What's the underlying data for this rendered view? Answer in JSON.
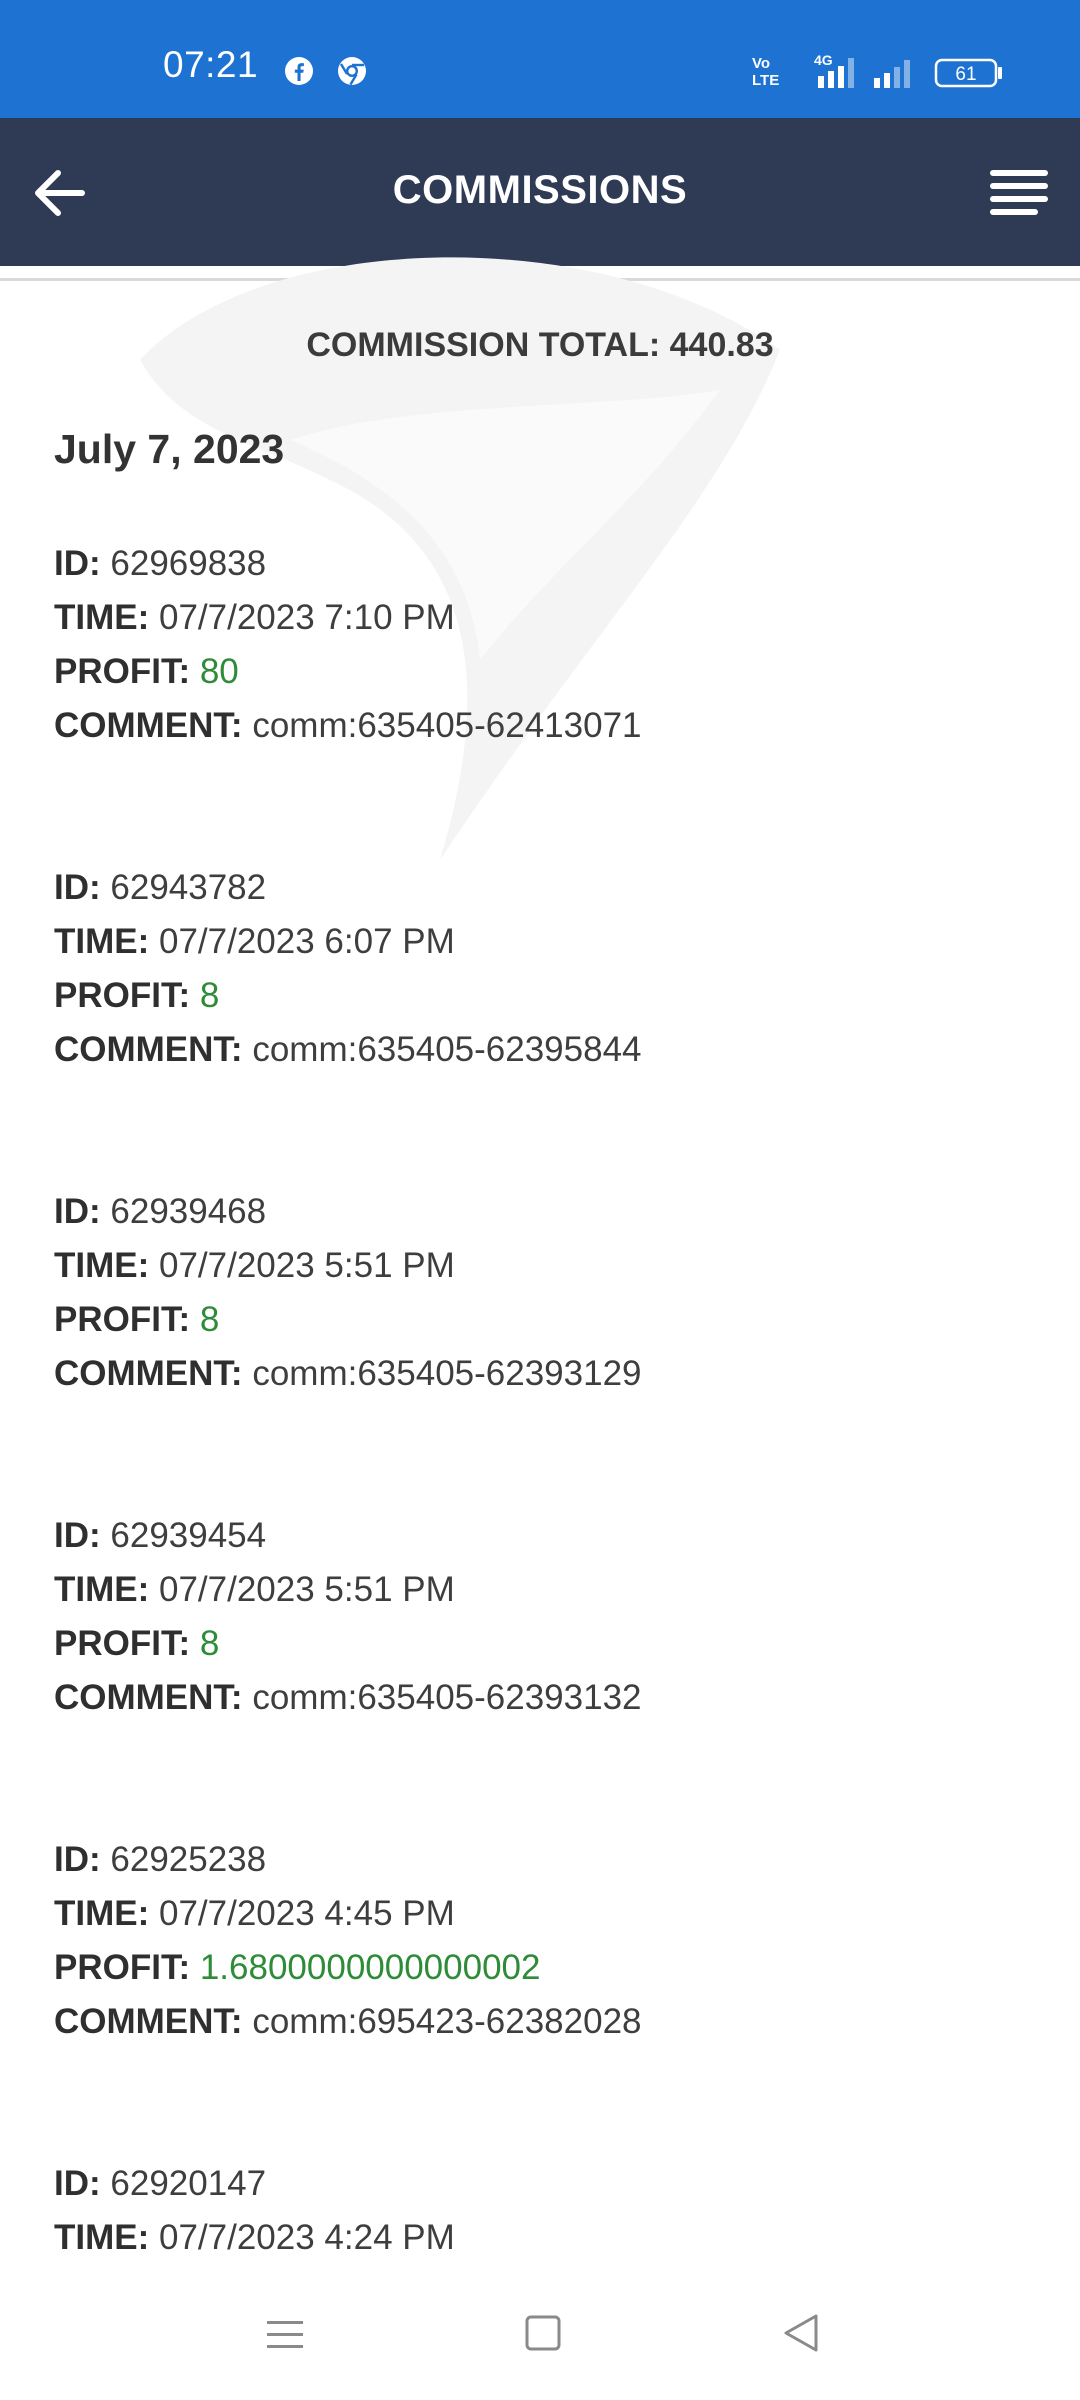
{
  "status_bar": {
    "time": "07:21",
    "icons": [
      "facebook-icon",
      "chrome-icon",
      "volte-icon",
      "signal-4g-icon",
      "signal-icon",
      "battery-icon"
    ],
    "volte_label": "Vo LTE",
    "network_label": "4G",
    "battery": "61"
  },
  "toolbar": {
    "title": "COMMISSIONS",
    "back_icon": "back-arrow-icon",
    "menu_icon": "menu-icon"
  },
  "summary": {
    "total_text": "COMMISSION TOTAL: 440.83"
  },
  "date_heading": "July 7, 2023",
  "labels": {
    "id": "ID:",
    "time": "TIME:",
    "profit": "PROFIT:",
    "comment": "COMMENT:"
  },
  "records": [
    {
      "id": "62969838",
      "time": "07/7/2023 7:10 PM",
      "profit": "80",
      "comment": "comm:635405-62413071"
    },
    {
      "id": "62943782",
      "time": "07/7/2023 6:07 PM",
      "profit": "8",
      "comment": "comm:635405-62395844"
    },
    {
      "id": "62939468",
      "time": "07/7/2023 5:51 PM",
      "profit": "8",
      "comment": "comm:635405-62393129"
    },
    {
      "id": "62939454",
      "time": "07/7/2023 5:51 PM",
      "profit": "8",
      "comment": "comm:635405-62393132"
    },
    {
      "id": "62925238",
      "time": "07/7/2023 4:45 PM",
      "profit": "1.6800000000000002",
      "comment": "comm:695423-62382028"
    },
    {
      "id": "62920147",
      "time": "07/7/2023 4:24 PM",
      "profit": "",
      "comment": ""
    }
  ],
  "colors": {
    "status_bar": "#1d72d2",
    "toolbar": "#2f3a54",
    "profit": "#2e8b38"
  },
  "nav_bar": {
    "icons": [
      "recents-icon",
      "home-icon",
      "back-icon"
    ]
  }
}
